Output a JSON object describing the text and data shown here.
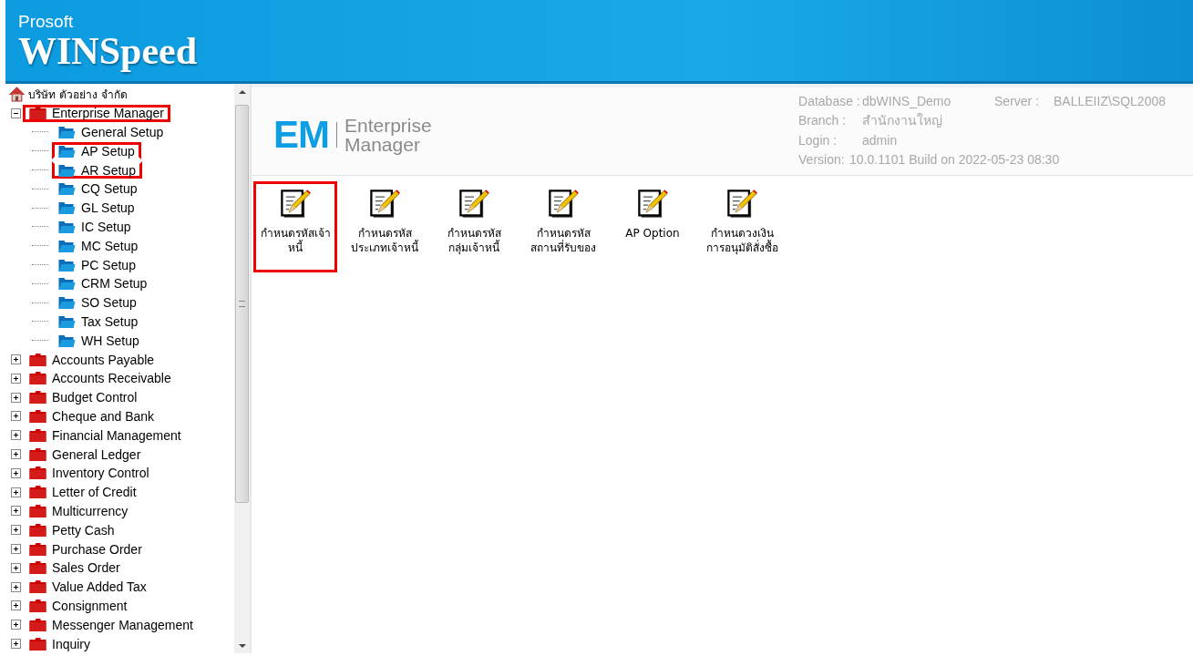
{
  "header": {
    "brand": "Prosoft",
    "product": "WINSpeed"
  },
  "tree": {
    "root": "บริษัท ตัวอย่าง จำกัด",
    "items": [
      {
        "label": "Enterprise Manager",
        "expanded": true,
        "highlighted": true,
        "children": [
          {
            "label": "General Setup",
            "highlighted": false
          },
          {
            "label": "AP Setup",
            "highlighted": true
          },
          {
            "label": "AR Setup",
            "highlighted": true
          },
          {
            "label": "CQ Setup",
            "highlighted": false
          },
          {
            "label": "GL Setup",
            "highlighted": false
          },
          {
            "label": "IC Setup",
            "highlighted": false
          },
          {
            "label": "MC Setup",
            "highlighted": false
          },
          {
            "label": "PC Setup",
            "highlighted": false
          },
          {
            "label": "CRM Setup",
            "highlighted": false
          },
          {
            "label": "SO Setup",
            "highlighted": false
          },
          {
            "label": "Tax Setup",
            "highlighted": false
          },
          {
            "label": "WH Setup",
            "highlighted": false
          }
        ]
      },
      {
        "label": "Accounts Payable",
        "expanded": false,
        "highlighted": false
      },
      {
        "label": "Accounts Receivable",
        "expanded": false,
        "highlighted": false
      },
      {
        "label": "Budget Control",
        "expanded": false,
        "highlighted": false
      },
      {
        "label": "Cheque and Bank",
        "expanded": false,
        "highlighted": false
      },
      {
        "label": "Financial Management",
        "expanded": false,
        "highlighted": false
      },
      {
        "label": "General Ledger",
        "expanded": false,
        "highlighted": false
      },
      {
        "label": "Inventory Control",
        "expanded": false,
        "highlighted": false
      },
      {
        "label": "Letter of Credit",
        "expanded": false,
        "highlighted": false
      },
      {
        "label": "Multicurrency",
        "expanded": false,
        "highlighted": false
      },
      {
        "label": "Petty Cash",
        "expanded": false,
        "highlighted": false
      },
      {
        "label": "Purchase Order",
        "expanded": false,
        "highlighted": false
      },
      {
        "label": "Sales Order",
        "expanded": false,
        "highlighted": false
      },
      {
        "label": "Value Added Tax",
        "expanded": false,
        "highlighted": false
      },
      {
        "label": "Consignment",
        "expanded": false,
        "highlighted": false
      },
      {
        "label": "Messenger Management",
        "expanded": false,
        "highlighted": false
      },
      {
        "label": "Inquiry",
        "expanded": false,
        "highlighted": false
      }
    ]
  },
  "module": {
    "logo": "EM",
    "title_lines": [
      "Enterprise",
      "Manager"
    ]
  },
  "info": [
    {
      "label": "Database :",
      "value": "dbWINS_Demo"
    },
    {
      "label": "Server :",
      "value": "BALLEIIZ\\SQL2008"
    },
    {
      "label": "Branch :",
      "value": "สำนักงานใหญ่"
    },
    {
      "label": "Login :",
      "value": "admin"
    },
    {
      "label": "Version:",
      "value": "10.0.1101  Build on 2022-05-23 08:30"
    }
  ],
  "tiles": [
    {
      "lines": [
        "กำหนดรหัสเจ้า",
        "หนี้"
      ],
      "highlighted": true
    },
    {
      "lines": [
        "กำหนดรหัส",
        "ประเภทเจ้าหนี้"
      ],
      "highlighted": false
    },
    {
      "lines": [
        "กำหนดรหัส",
        "กลุ่มเจ้าหนี้"
      ],
      "highlighted": false
    },
    {
      "lines": [
        "กำหนดรหัส",
        "สถานที่รับของ"
      ],
      "highlighted": false
    },
    {
      "lines": [
        "AP Option"
      ],
      "highlighted": false
    },
    {
      "lines": [
        "กำหนดวงเงิน",
        "การอนุมัติสั่งซื้อ"
      ],
      "highlighted": false
    }
  ]
}
